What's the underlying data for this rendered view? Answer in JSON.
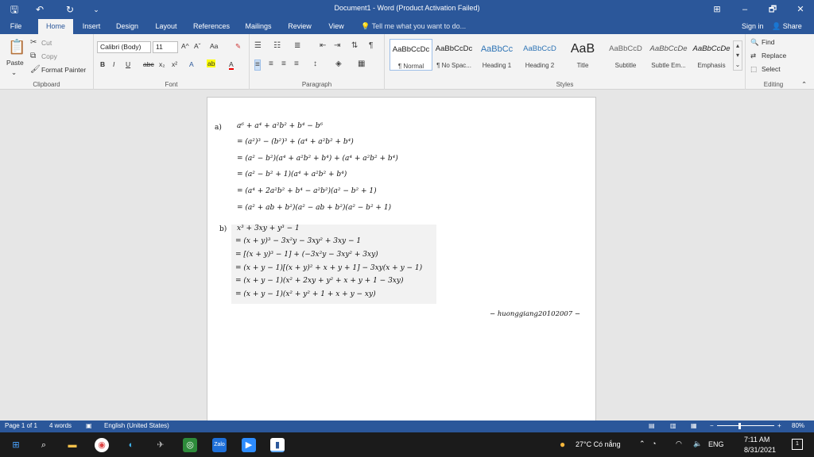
{
  "window": {
    "title": "Document1 - Word (Product Activation Failed)",
    "quick_access": {
      "save_glyph": "🖫",
      "undo_glyph": "↶",
      "redo_glyph": "↻",
      "customize_glyph": "⌄"
    },
    "controls": {
      "restore_ribbon": "⊞",
      "minimize": "–",
      "maximize": "🗗",
      "close": "✕"
    }
  },
  "tabs": {
    "items": [
      "File",
      "Home",
      "Insert",
      "Design",
      "Layout",
      "References",
      "Mailings",
      "Review",
      "View"
    ],
    "tell_me": "Tell me what you want to do...",
    "sign_in": "Sign in",
    "share": "Share"
  },
  "ribbon": {
    "clipboard": {
      "paste": "Paste",
      "cut": "Cut",
      "copy": "Copy",
      "format_painter": "Format Painter",
      "label": "Clipboard"
    },
    "font": {
      "font_name": "Calibri (Body)",
      "font_size": "11",
      "label": "Font",
      "bold": "B",
      "italic": "I",
      "underline": "U",
      "strike": "abc",
      "sub": "x₂",
      "sup": "x²",
      "grow": "A^",
      "shrink": "Aˇ",
      "case": "Aa",
      "clear": "A"
    },
    "paragraph": {
      "label": "Paragraph"
    },
    "styles": {
      "label": "Styles",
      "items": [
        {
          "sample": "AaBbCcDc",
          "name": "¶ Normal"
        },
        {
          "sample": "AaBbCcDc",
          "name": "¶ No Spac..."
        },
        {
          "sample": "AaBbCc",
          "name": "Heading 1"
        },
        {
          "sample": "AaBbCcD",
          "name": "Heading 2"
        },
        {
          "sample": "AaB",
          "name": "Title"
        },
        {
          "sample": "AaBbCcD",
          "name": "Subtitle"
        },
        {
          "sample": "AaBbCcDe",
          "name": "Subtle Em..."
        },
        {
          "sample": "AaBbCcDe",
          "name": "Emphasis"
        }
      ]
    },
    "editing": {
      "find": "Find",
      "replace": "Replace",
      "select": "Select",
      "label": "Editing"
    }
  },
  "document": {
    "part_a": {
      "label": "a)",
      "lines": [
        "a⁶ + a⁴ + a²b² + b⁴ − b⁶",
        "= (a²)³ − (b²)³ + (a⁴ + a²b² + b⁴)",
        "= (a² − b²)(a⁴ + a²b² + b⁴) + (a⁴ + a²b² + b⁴)",
        "= (a² − b² + 1)(a⁴ + a²b² + b⁴)",
        "= (a⁴ + 2a²b² + b⁴ − a²b²)(a² − b² + 1)",
        "= (a² + ab + b²)(a² − ab + b²)(a² − b² + 1)"
      ]
    },
    "part_b": {
      "label": "b)",
      "lines": [
        "x³ + 3xy + y³ − 1",
        "= (x + y)³ − 3x²y − 3xy² + 3xy − 1",
        "= [(x + y)³ − 1] + (−3x²y − 3xy² + 3xy)",
        "= (x + y − 1)[(x + y)² + x + y + 1] − 3xy(x + y − 1)",
        "= (x + y − 1)(x² + 2xy + y² + x + y + 1 − 3xy)",
        "= (x + y − 1)(x² + y² + 1 + x + y − xy)"
      ]
    },
    "signature": "− huonggiang20102007 −"
  },
  "status": {
    "page": "Page 1 of 1",
    "words": "4 words",
    "language": "English (United States)",
    "zoom": "80%"
  },
  "taskbar": {
    "weather": "27°C  Có nắng",
    "lang": "ENG",
    "time": "7:11 AM",
    "date": "8/31/2021",
    "notifications": "1"
  },
  "colors": {
    "accent": "#2b579a",
    "ribbon_bg": "#f3f3f3",
    "taskbar": "#1b1b1b"
  }
}
